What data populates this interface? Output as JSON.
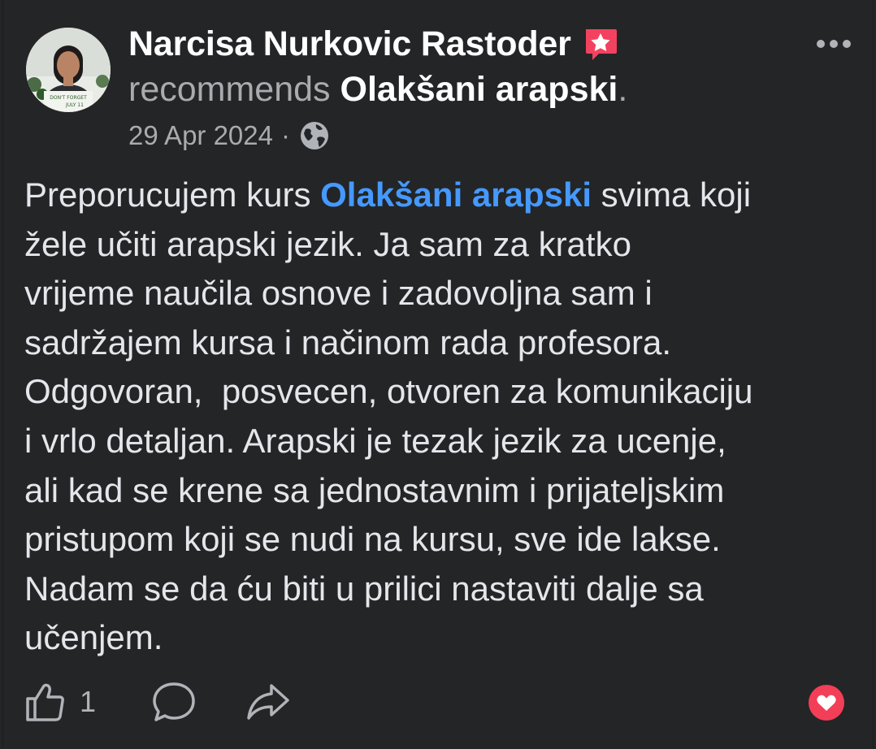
{
  "post": {
    "author_name": "Narcisa Nurkovic Rastoder",
    "recommends_word": "recommends",
    "page_name": "Olakšani arapski",
    "period": ".",
    "date": "29 Apr 2024",
    "separator": "·",
    "audience_icon": "globe-icon",
    "badge_icon": "recommendation-star-icon",
    "avatar_caption": "DON'T FORGET",
    "avatar_subcaption": "JULY 11"
  },
  "review": {
    "lines": [
      {
        "before": "Preporucujem kurs ",
        "link": "Olakšani arapski",
        "after": " svima koji"
      },
      {
        "text": "žele učiti arapski jezik. Ja sam za kratko"
      },
      {
        "text": "vrijeme naučila osnove i zadovoljna sam i"
      },
      {
        "text": "sadržajem kursa i načinom rada profesora."
      },
      {
        "text": "Odgovoran,  posvecen, otvoren za komunikaciju"
      },
      {
        "text": "i vrlo detaljan. Arapski je tezak jezik za ucenje,"
      },
      {
        "text": "ali kad se krene sa jednostavnim i prijateljskim"
      },
      {
        "text": "pristupom koji se nudi na kursu, sve ide lakse."
      },
      {
        "text": "Nadam se da ću biti u prilici nastaviti dalje sa"
      },
      {
        "text": "učenjem."
      }
    ]
  },
  "actions": {
    "like_count": "1",
    "like_icon": "thumbs-up-icon",
    "comment_icon": "comment-bubble-icon",
    "share_icon": "share-arrow-icon",
    "more_icon": "more-dots-icon",
    "reaction_icon": "love-heart-icon"
  },
  "colors": {
    "background": "#242526",
    "link_blue": "#4599ff",
    "text": "#e4e6eb",
    "secondary_text": "#a8abaf",
    "badge_pink": "#f3425f",
    "love_red": "#f33e58"
  }
}
